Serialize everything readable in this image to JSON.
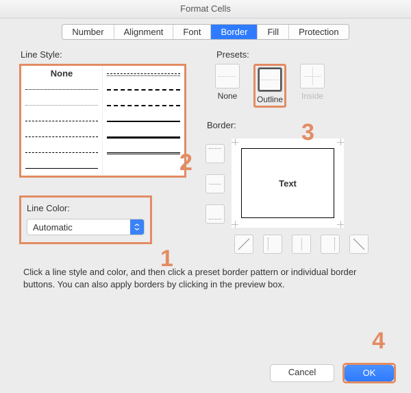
{
  "window": {
    "title": "Format Cells"
  },
  "tabs": [
    "Number",
    "Alignment",
    "Font",
    "Border",
    "Fill",
    "Protection"
  ],
  "active_tab_index": 3,
  "left": {
    "line_style_label": "Line Style:",
    "none_label": "None",
    "line_color_label": "Line Color:",
    "line_color_value": "Automatic"
  },
  "right": {
    "presets_label": "Presets:",
    "presets": [
      {
        "key": "none",
        "label": "None"
      },
      {
        "key": "outline",
        "label": "Outline"
      },
      {
        "key": "inside",
        "label": "Inside"
      }
    ],
    "border_label": "Border:",
    "preview_text": "Text"
  },
  "hint": "Click a line style and color, and then click a preset border pattern or individual border buttons. You can also apply borders by clicking in the preview box.",
  "buttons": {
    "cancel": "Cancel",
    "ok": "OK"
  },
  "annotations": {
    "a1": "1",
    "a2": "2",
    "a3": "3",
    "a4": "4"
  },
  "colors": {
    "highlight": "#e38b63",
    "primary": "#2f7bff"
  }
}
